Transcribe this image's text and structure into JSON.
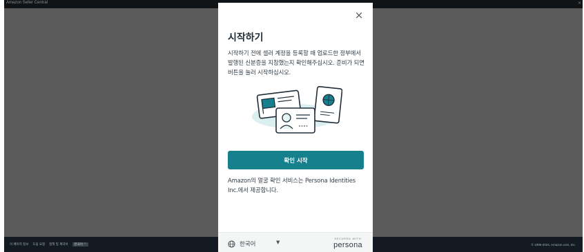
{
  "window": {
    "title": "Amazon Seller Central",
    "corner_glyph": "×"
  },
  "modal": {
    "close_glyph": "×",
    "heading": "시작하기",
    "description": "시작하기 전에 셀러 계정을 등록할 때 업로드한 정부에서 발행된 신분증을 지참했는지 확인해주십시오. 준비가 되면 버튼을 눌러 시작하십시오.",
    "primary_button": "확인 시작",
    "note": "Amazon의 얼굴 확인 서비스는 Persona Identities Inc.에서 제공합니다.",
    "language": "한국어",
    "language_chevron": "▼",
    "secured_label": "SECURED WITH",
    "brand": "persona"
  },
  "footer": {
    "links": [
      "이 페이지 정보",
      "도움 요청",
      "정책 및 계약서"
    ],
    "language_chip": "한국어 ⌃",
    "copyright": "© 1996-2024, Amazon.com, Inc."
  },
  "colors": {
    "backdrop": "#5b5b5b",
    "primary": "#17808d",
    "heading": "#1f2b36",
    "footer_bg": "#131a22"
  }
}
